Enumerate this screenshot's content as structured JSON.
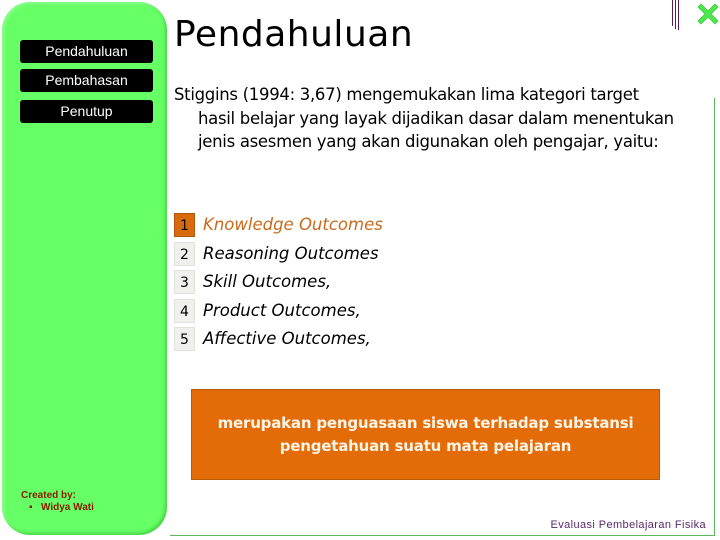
{
  "sidebar": {
    "nav": [
      {
        "label": "Pendahuluan"
      },
      {
        "label": "Pembahasan"
      },
      {
        "label": "Penutup"
      }
    ],
    "credits": {
      "heading": "Created by:",
      "bullet": "▪",
      "author": "Widya Wati"
    }
  },
  "slide": {
    "title": "Pendahuluan",
    "intro": "Stiggins (1994: 3,67) mengemukakan lima kategori target hasil belajar yang layak dijadikan dasar dalam menentukan jenis asesmen yang akan digunakan oleh pengajar, yaitu:",
    "outcomes": [
      {
        "num": "1",
        "label": "Knowledge Outcomes",
        "active": true
      },
      {
        "num": "2",
        "label": "Reasoning Outcomes",
        "active": false
      },
      {
        "num": "3",
        "label": "Skill Outcomes,",
        "active": false
      },
      {
        "num": "4",
        "label": "Product Outcomes,",
        "active": false
      },
      {
        "num": "5",
        "label": "Affective Outcomes,",
        "active": false
      }
    ],
    "definition": "merupakan penguasaan siswa terhadap substansi pengetahuan suatu mata pelajaran",
    "footer": "Evaluasi Pembelajaran Fisika"
  },
  "icons": {
    "close": "close-x-icon"
  },
  "colors": {
    "sidebar_green": "#66ff66",
    "accent_orange": "#e36c09",
    "active_text": "#c96b1c",
    "credits_text": "#8b1a00",
    "footer_text": "#5a2a6a",
    "frame_green": "#5cb85c"
  }
}
